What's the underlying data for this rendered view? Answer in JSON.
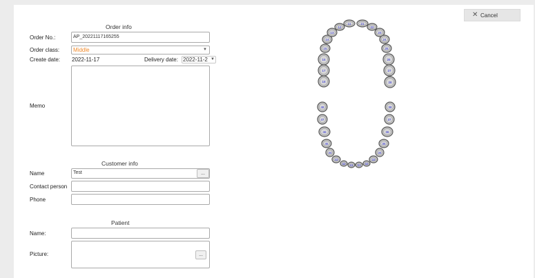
{
  "cancel_button": {
    "label": "Cancel",
    "icon": "close-icon"
  },
  "order_info": {
    "title": "Order info",
    "order_no_label": "Order No.:",
    "order_no_value": "AP_20221117165255",
    "order_class_label": "Order class:",
    "order_class_value": "Middle",
    "order_class_color": "#f08a2c",
    "create_date_label": "Create date:",
    "create_date_value": "2022-11-17",
    "delivery_date_label": "Delivery date:",
    "delivery_date_value": "2022-11-2",
    "memo_label": "Memo",
    "memo_value": ""
  },
  "customer_info": {
    "title": "Customer info",
    "name_label": "Name",
    "name_value": "Test",
    "browse_label": "...",
    "contact_label": "Contact person",
    "contact_value": "",
    "phone_label": "Phone",
    "phone_value": ""
  },
  "patient": {
    "title": "Patient",
    "name_label": "Name:",
    "name_value": "",
    "picture_label": "Picture:",
    "browse_label": "..."
  },
  "dental_chart": {
    "tooth_fill": "#c4c4c4",
    "tooth_stroke": "#5a5a5a",
    "label_color": "#2b2bd6",
    "upper": [
      "18",
      "17",
      "16",
      "15",
      "14",
      "13",
      "12",
      "11",
      "21",
      "22",
      "23",
      "24",
      "25",
      "26",
      "27",
      "28"
    ],
    "lower": [
      "48",
      "47",
      "46",
      "45",
      "44",
      "43",
      "42",
      "41",
      "31",
      "32",
      "33",
      "34",
      "35",
      "36",
      "37",
      "38"
    ]
  }
}
